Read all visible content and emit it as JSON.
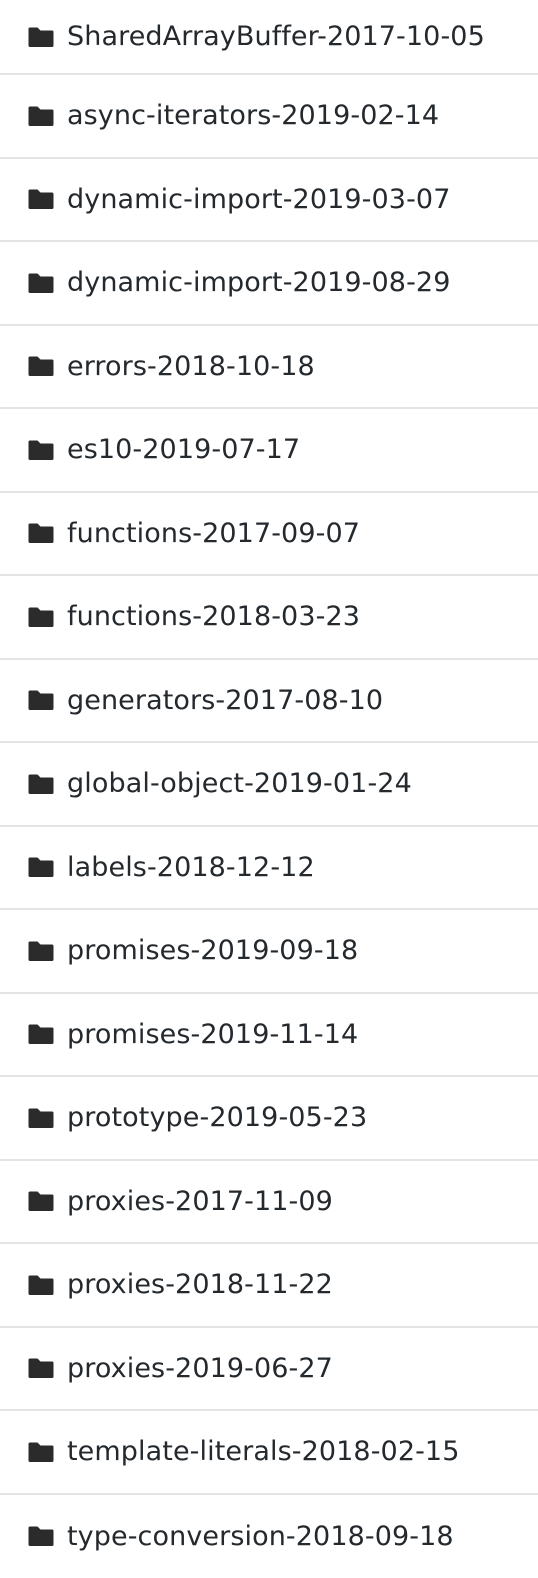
{
  "file_list": {
    "item_icon": "folder-icon",
    "icon_color": "#2b2b2b",
    "text_color": "#24292e",
    "divider_color": "#e4e4e4",
    "items": [
      {
        "label": "SharedArrayBuffer-2017-10-05"
      },
      {
        "label": "async-iterators-2019-02-14"
      },
      {
        "label": "dynamic-import-2019-03-07"
      },
      {
        "label": "dynamic-import-2019-08-29"
      },
      {
        "label": "errors-2018-10-18"
      },
      {
        "label": "es10-2019-07-17"
      },
      {
        "label": "functions-2017-09-07"
      },
      {
        "label": "functions-2018-03-23"
      },
      {
        "label": "generators-2017-08-10"
      },
      {
        "label": "global-object-2019-01-24"
      },
      {
        "label": "labels-2018-12-12"
      },
      {
        "label": "promises-2019-09-18"
      },
      {
        "label": "promises-2019-11-14"
      },
      {
        "label": "prototype-2019-05-23"
      },
      {
        "label": "proxies-2017-11-09"
      },
      {
        "label": "proxies-2018-11-22"
      },
      {
        "label": "proxies-2019-06-27"
      },
      {
        "label": "template-literals-2018-02-15"
      },
      {
        "label": "type-conversion-2018-09-18"
      }
    ]
  }
}
